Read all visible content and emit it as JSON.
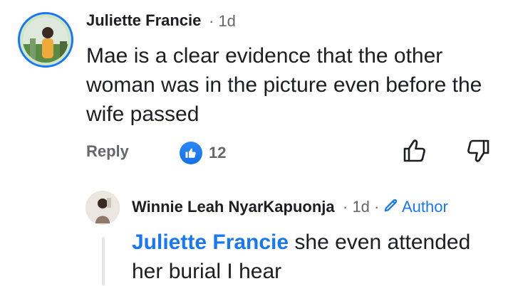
{
  "comment": {
    "author": "Juliette Francie",
    "time": "· 1d",
    "text": "Mae is a clear evidence that the other woman was in the picture even before the wife passed",
    "reply_label": "Reply",
    "like_count": "12",
    "colors": {
      "accent": "#1877f2",
      "meta": "#65676b",
      "text": "#1c1e21"
    }
  },
  "reply": {
    "author": "Winnie Leah NyarKapuonja",
    "time": "· 1d ·",
    "author_badge": "Author",
    "mention": "Juliette Francie",
    "text": "she even attended her burial I hear"
  },
  "icons": {
    "like_badge": "thumbs-up-icon",
    "like_button": "thumbs-up-outline-icon",
    "dislike_button": "thumbs-down-outline-icon",
    "author_badge": "pencil-icon"
  }
}
